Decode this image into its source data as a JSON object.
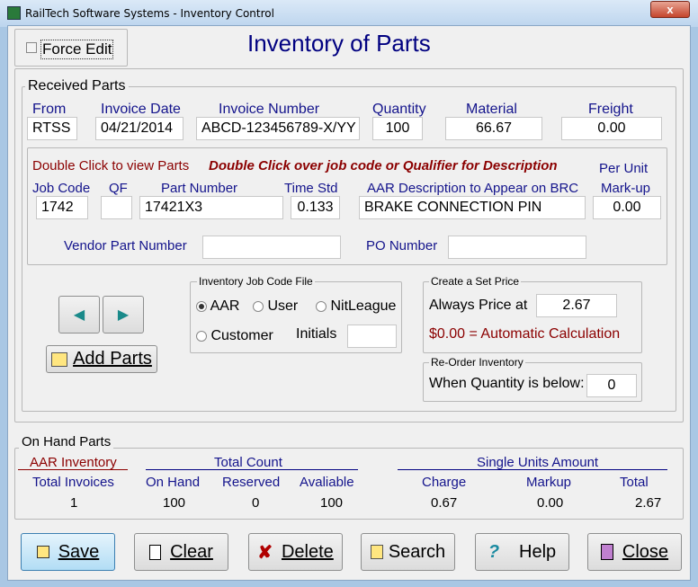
{
  "window": {
    "title": "RailTech Software Systems - Inventory Control",
    "close": "x"
  },
  "force_edit": {
    "label": "Force Edit",
    "checked": false
  },
  "page_title": "Inventory of Parts",
  "received": {
    "group_label": "Received Parts",
    "labels": {
      "from": "From",
      "invoice_date": "Invoice Date",
      "invoice_number": "Invoice Number",
      "quantity": "Quantity",
      "material": "Material",
      "freight": "Freight"
    },
    "values": {
      "from": "RTSS",
      "invoice_date": "04/21/2014",
      "invoice_number": "ABCD-123456789-X/YY",
      "quantity": "100",
      "material": "66.67",
      "freight": "0.00"
    },
    "hint1": "Double Click to view Parts",
    "hint2": "Double Click over job code or Qualifier for  Description",
    "part_labels": {
      "job_code": "Job Code",
      "qf": "QF",
      "part_number": "Part Number",
      "time_std": "Time Std",
      "aar_desc": "AAR Description to Appear on BRC",
      "per_unit": "Per Unit",
      "markup": "Mark-up",
      "vendor_part": "Vendor Part Number",
      "po_number": "PO Number"
    },
    "part_values": {
      "job_code": "1742",
      "qf": "",
      "part_number": "17421X3",
      "time_std": "0.133",
      "aar_desc": "BRAKE CONNECTION PIN",
      "markup": "0.00",
      "vendor_part": "",
      "po_number": ""
    }
  },
  "add_parts": "Add Parts",
  "job_code_file": {
    "label": "Inventory Job Code File",
    "options": [
      "AAR",
      "User",
      "NitLeague",
      "Customer"
    ],
    "selected": "AAR",
    "initials_label": "Initials",
    "initials": ""
  },
  "set_price": {
    "label": "Create a Set Price",
    "always_label": "Always Price at",
    "value": "2.67",
    "note": "$0.00 = Automatic Calculation"
  },
  "reorder": {
    "label": "Re-Order Inventory",
    "when_label": "When Quantity is below:",
    "value": "0"
  },
  "on_hand": {
    "group_label": "On Hand Parts",
    "aar_inventory": "AAR Inventory",
    "total_count": "Total Count",
    "single_units": "Single Units Amount",
    "headers": {
      "total_invoices": "Total Invoices",
      "on_hand": "On Hand",
      "reserved": "Reserved",
      "available": "Avaliable",
      "charge": "Charge",
      "markup": "Markup",
      "total": "Total"
    },
    "values": {
      "total_invoices": "1",
      "on_hand": "100",
      "reserved": "0",
      "available": "100",
      "charge": "0.67",
      "markup": "0.00",
      "total": "2.67"
    }
  },
  "buttons": {
    "save": "Save",
    "clear": "Clear",
    "delete": "Delete",
    "search": "Search",
    "help": "Help",
    "close": "Close"
  }
}
